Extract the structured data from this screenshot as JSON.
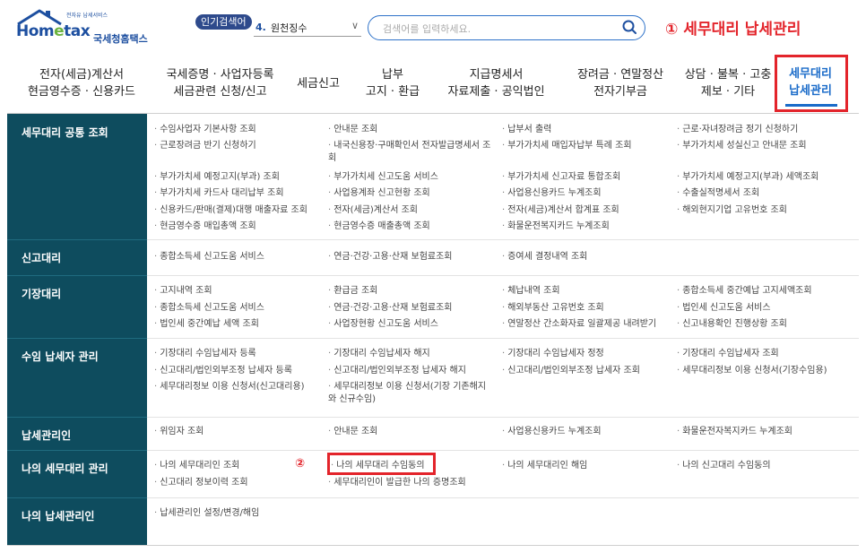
{
  "header": {
    "logo_small": "전자유 납세서비스",
    "logo_word_a": "Hom",
    "logo_word_e": "e",
    "logo_word_b": "tax",
    "logo_kr": "국세청홈택스",
    "popular_badge": "인기검색어",
    "popular_num": "4.",
    "popular_keyword": "원천징수",
    "search_placeholder": "검색어를 입력하세요.",
    "annotation_1": "① 세무대리 납세관리",
    "accent_color": "#e3242b",
    "brand_color": "#1d4fa0"
  },
  "nav": {
    "items": [
      {
        "line1": "전자(세금)계산서",
        "line2": "현금영수증 · 신용카드"
      },
      {
        "line1": "국세증명 · 사업자등록",
        "line2": "세금관련 신청/신고"
      },
      {
        "line1": "세금신고",
        "line2": ""
      },
      {
        "line1": "납부",
        "line2": "고지 · 환급"
      },
      {
        "line1": "지급명세서",
        "line2": "자료제출 · 공익법인"
      },
      {
        "line1": "장려금 · 연말정산",
        "line2": "전자기부금"
      },
      {
        "line1": "상담 · 불복 · 고충",
        "line2": "제보 · 기타"
      }
    ],
    "active": {
      "line1": "세무대리",
      "line2": "납세관리"
    }
  },
  "menu": {
    "categories": [
      "세무대리 공통 조회",
      "신고대리",
      "기장대리",
      "수임 납세자 관리",
      "납세관리인",
      "나의 세무대리 관리",
      "나의 납세관리인"
    ],
    "links": [
      "수임사업자 기본사항 조회",
      "안내문 조회",
      "납부서 출력",
      "근로·자녀장려금 정기 신청하기",
      "근로장려금 반기 신청하기",
      "내국신용장·구매확인서 전자발급명세서 조회",
      "부가가치세 매입자납부 특례 조회",
      "부가가치세 성실신고 안내문 조회",
      "부가가치세 예정고지(부과) 조회",
      "부가가치세 신고도움 서비스",
      "부가가치세 신고자료 통합조회",
      "부가가치세 예정고지(부과) 세액조회",
      "부가가치세 카드사 대리납부 조회",
      "사업용계좌 신고현황 조회",
      "사업용신용카드 누계조회",
      "수출실적명세서 조회",
      "신용카드/판매(결제)대행 매출자료 조회",
      "전자(세금)계산서 조회",
      "전자(세금)계산서 합계표 조회",
      "해외현지기업 고유번호 조회",
      "현금영수증 매입총액 조회",
      "현금영수증 매출총액 조회",
      "화물운전복지카드 누계조회",
      "종합소득세 신고도움 서비스",
      "연금·건강·고용·산재 보험료조회",
      "증여세 결정내역 조회",
      "고지내역 조회",
      "환급금 조회",
      "체납내역 조회",
      "종합소득세 중간예납 고지세액조회",
      "종합소득세 신고도움 서비스",
      "연금·건강·고용·산재 보험료조회",
      "해외부동산 고유번호 조회",
      "법인세 신고도움 서비스",
      "법인세 중간예납 세액 조회",
      "사업장현황 신고도움 서비스",
      "연말정산 간소화자료 일괄제공 내려받기",
      "신고내용확인 진행상황 조회",
      "기장대리 수임납세자 등록",
      "기장대리 수임납세자 해지",
      "기장대리 수임납세자 정정",
      "기장대리 수임납세자 조회",
      "신고대리/법인외부조정 납세자 등록",
      "신고대리/법인외부조정 납세자 해지",
      "신고대리/법인외부조정 납세자 조회",
      "세무대리정보 이용 신청서(기장수임용)",
      "세무대리정보 이용 신청서(신고대리용)",
      "세무대리정보 이용 신청서(기장 기존해지와 신규수임)",
      "위임자 조회",
      "안내문 조회",
      "사업용신용카드 누계조회",
      "화물운전자복지카드 누계조회",
      "나의 세무대리인 조회",
      "나의 세무대리 수임동의",
      "나의 세무대리인 해임",
      "나의 신고대리 수임동의",
      "신고대리 정보이력 조회",
      "세무대리인이 발급한 나의 증명조회",
      "납세관리인 설정/변경/해임"
    ],
    "annotation_2": "②"
  }
}
